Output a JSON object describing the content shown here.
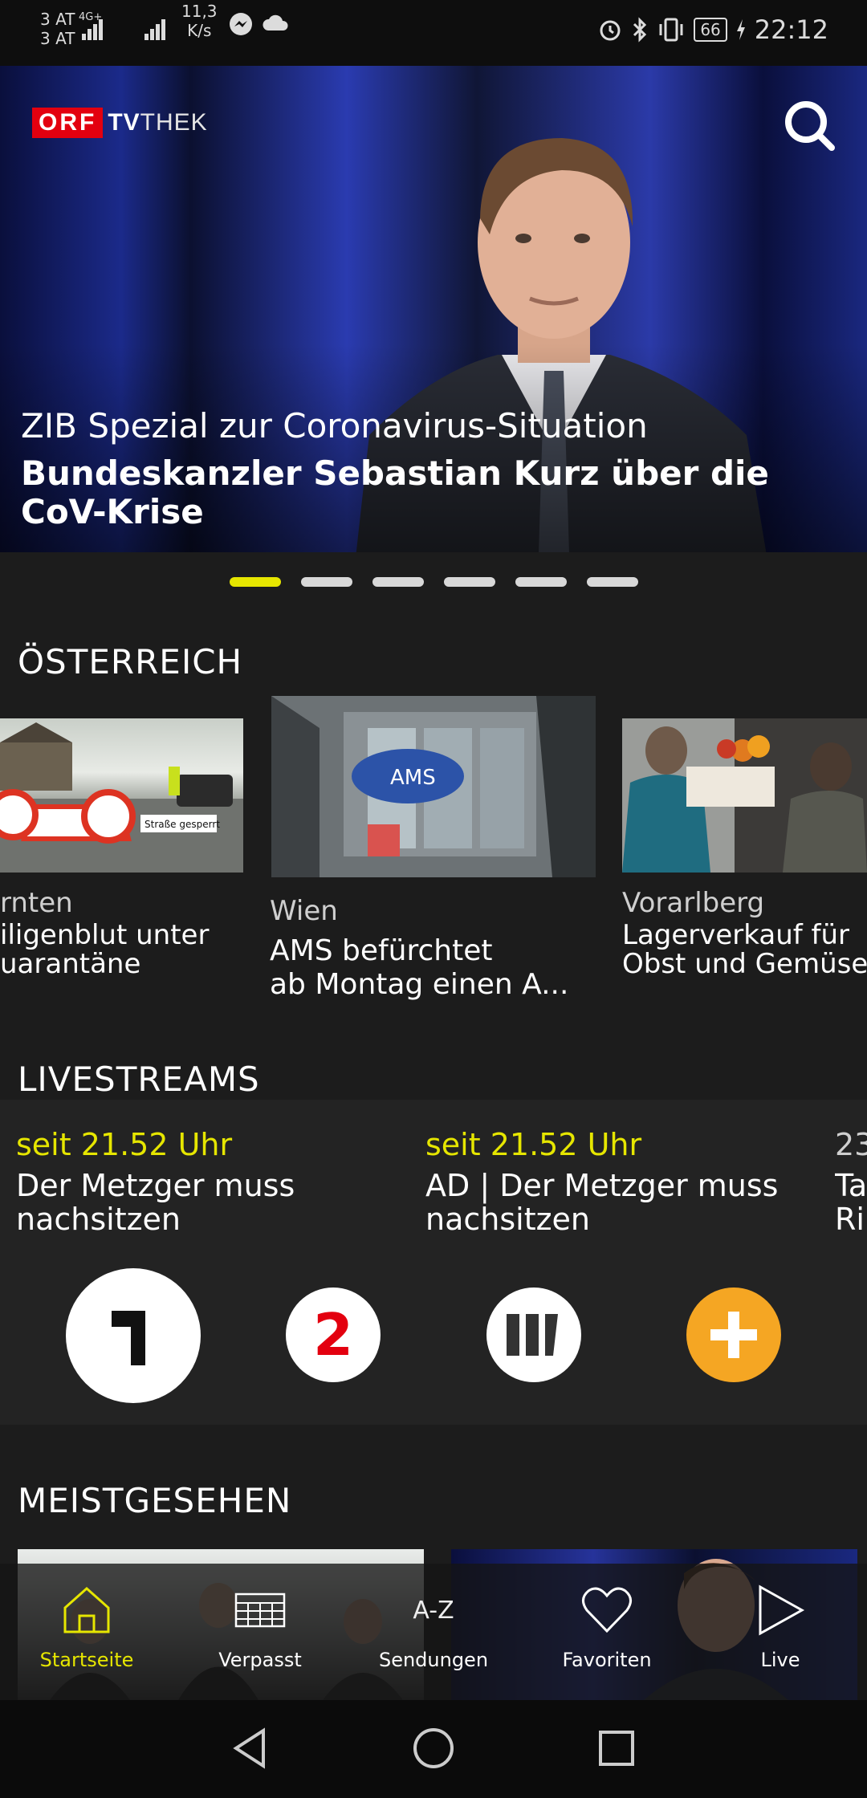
{
  "status_bar": {
    "carrier1": "3 AT",
    "carrier2": "3 AT",
    "network": "4G+",
    "speed_value": "11,3",
    "speed_unit": "K/s",
    "battery": "66",
    "time": "22:12"
  },
  "header": {
    "logo_orf": "ORF",
    "logo_tv": "TV",
    "logo_thek": "THEK"
  },
  "hero": {
    "kicker": "ZIB Spezial zur Coronavirus-Situation",
    "title": "Bundeskanzler Sebastian Kurz über die CoV-Krise",
    "pages": 6,
    "active_page": 1
  },
  "oesterreich": {
    "title": "ÖSTERREICH",
    "cards": [
      {
        "region": "rnten",
        "headline_line1": "iligenblut unter",
        "headline_line2": "uarantäne",
        "sign_text": "Straße gesperrt"
      },
      {
        "region": "Wien",
        "headline_line1": "AMS befürchtet",
        "headline_line2": "ab Montag einen A...",
        "sign_text": "AMS"
      },
      {
        "region": "Vorarlberg",
        "headline_line1": "Lagerverkauf für",
        "headline_line2": "Obst und Gemüse"
      }
    ]
  },
  "livestreams": {
    "title": "LIVESTREAMS",
    "items": [
      {
        "time": "seit 21.52 Uhr",
        "show_line1": "Der Metzger muss",
        "show_line2": "nachsitzen"
      },
      {
        "time": "seit 21.52 Uhr",
        "show_line1": "AD | Der Metzger muss",
        "show_line2": "nachsitzen"
      },
      {
        "time": "23",
        "show_line1": "Ta",
        "show_line2": "Ri"
      }
    ],
    "channels": [
      "ORF 1",
      "ORF 2",
      "ORF III",
      "ORF Plus"
    ]
  },
  "meistgesehen": {
    "title": "MEISTGESEHEN"
  },
  "bottom_nav": {
    "items": [
      {
        "label": "Startseite",
        "icon": "home-icon"
      },
      {
        "label": "Verpasst",
        "icon": "calendar-icon"
      },
      {
        "label": "Sendungen",
        "icon": "a-z-icon",
        "icon_text": "A-Z"
      },
      {
        "label": "Favoriten",
        "icon": "heart-icon"
      },
      {
        "label": "Live",
        "icon": "play-icon"
      }
    ]
  },
  "colors": {
    "accent": "#e6e600",
    "orf_red": "#e3000f",
    "background": "#1c1c1c",
    "channel_plus": "#f5a623"
  }
}
